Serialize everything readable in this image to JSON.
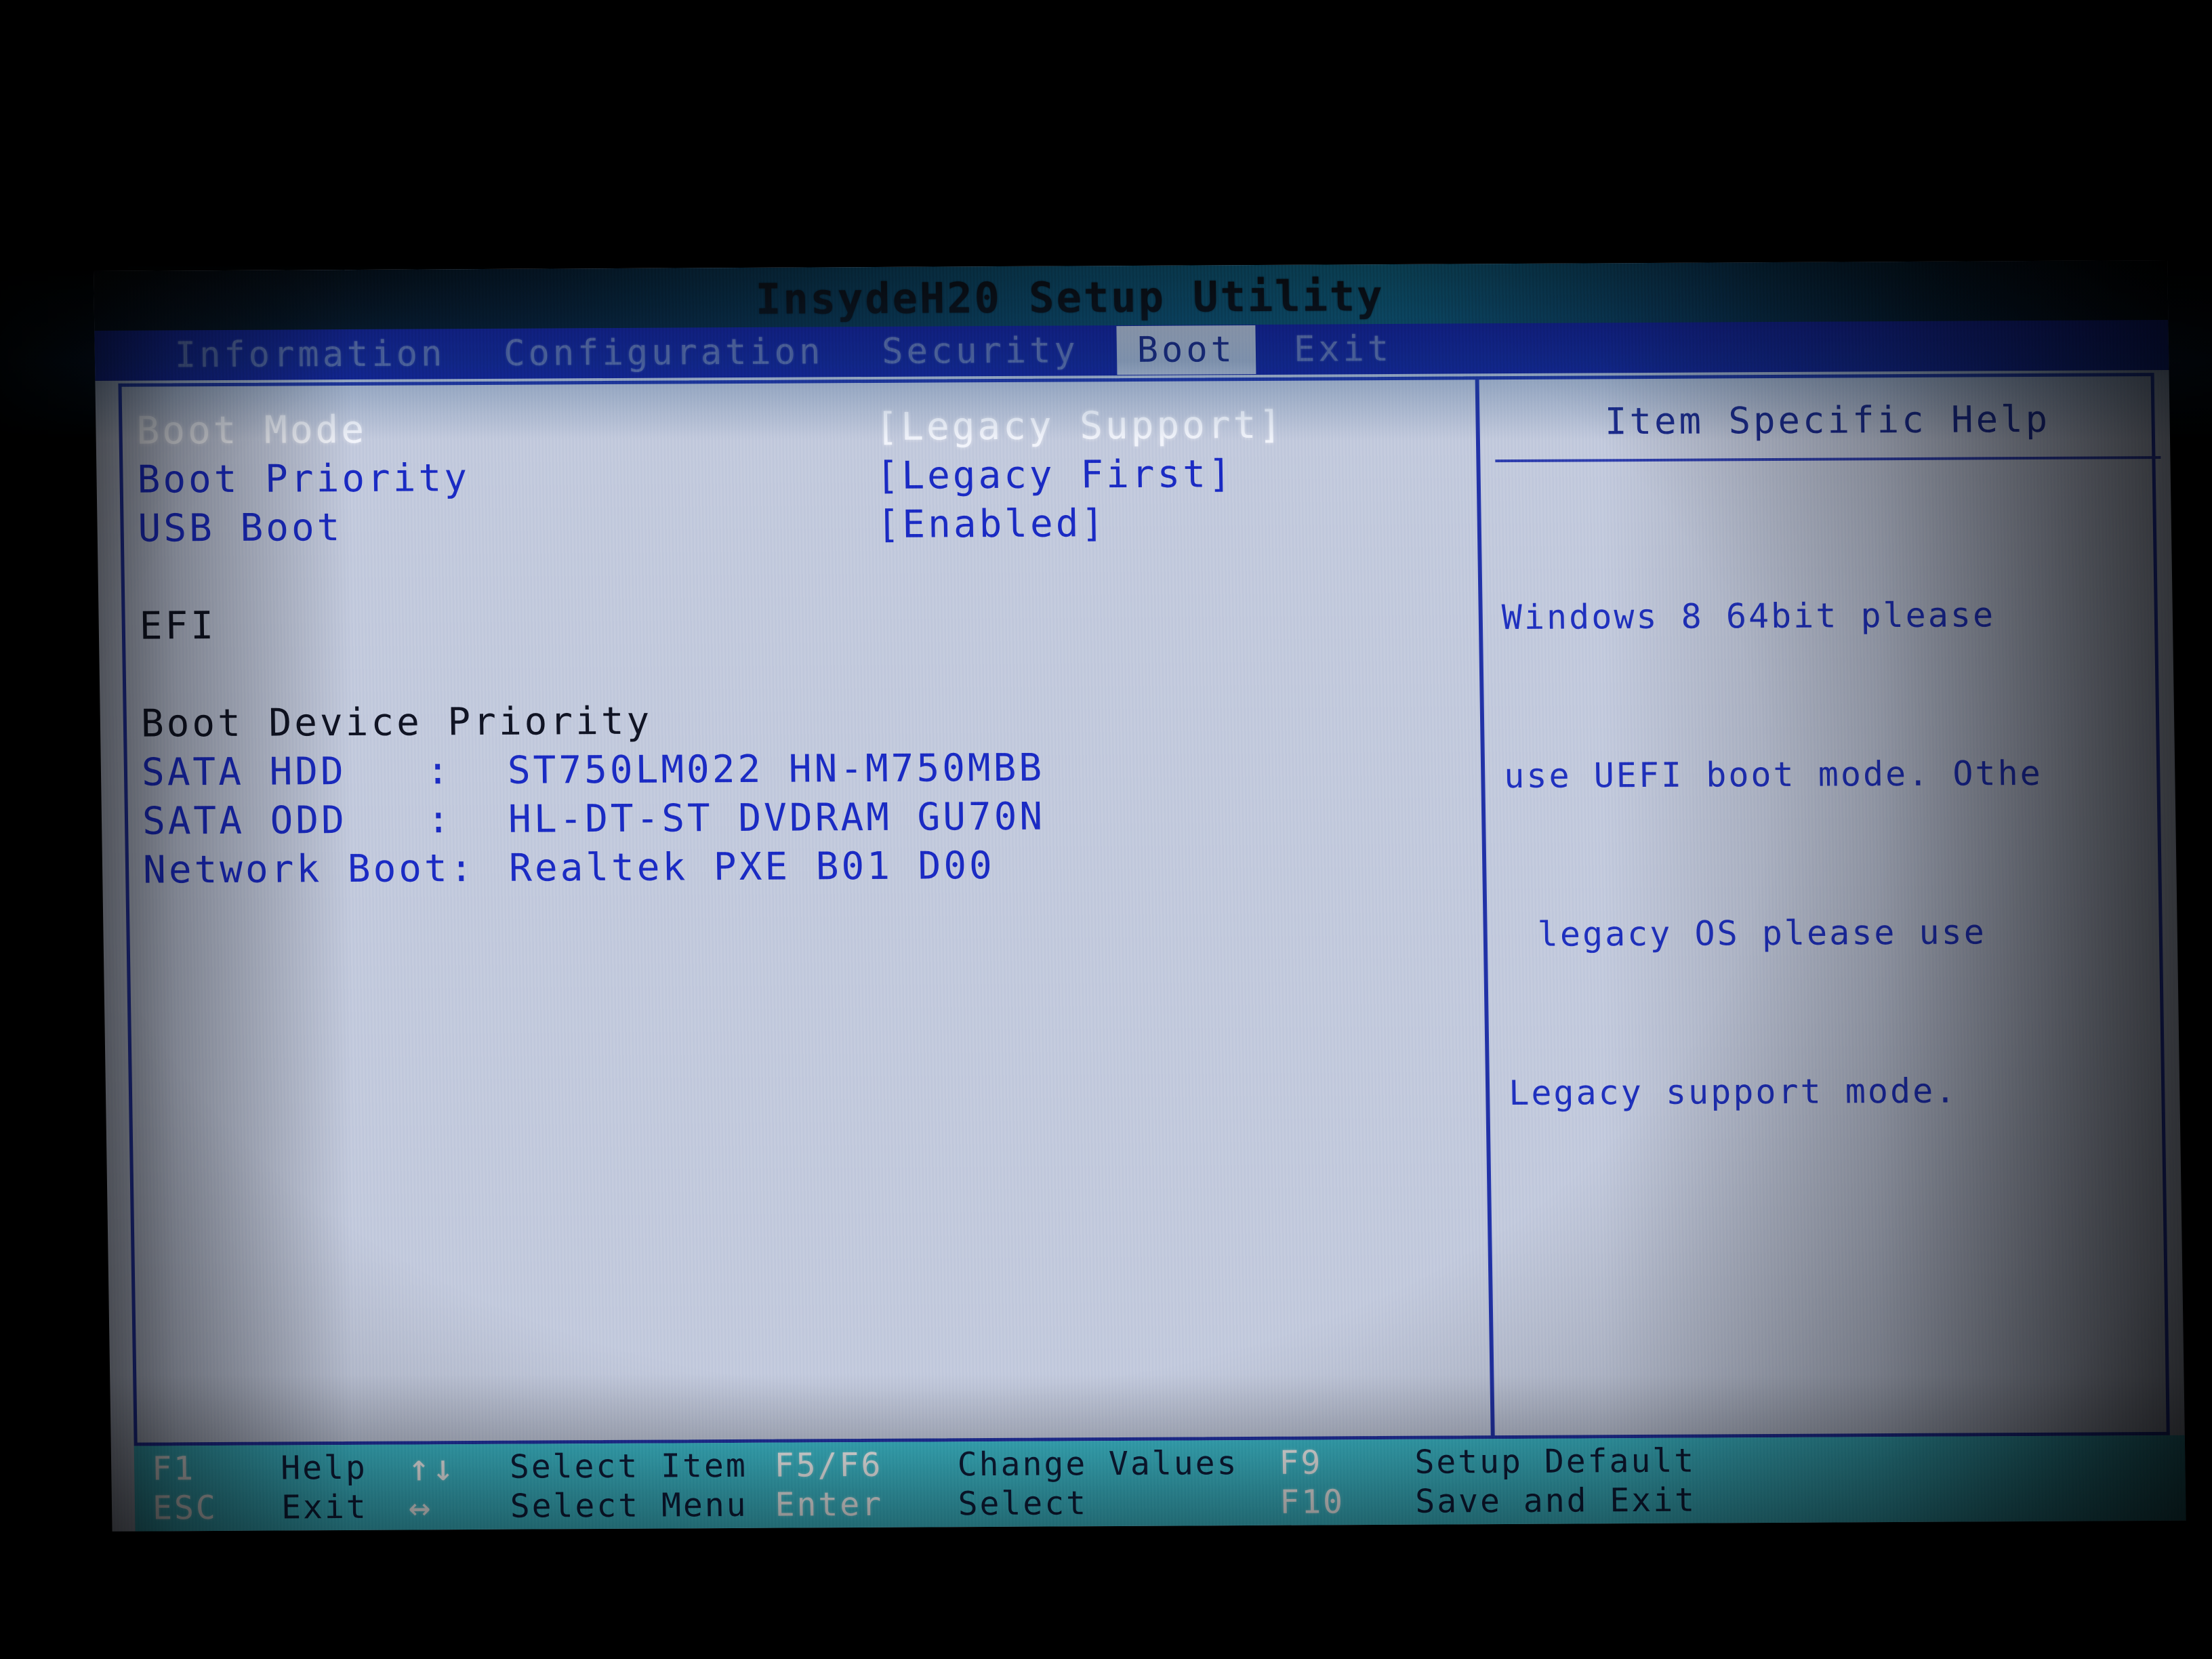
{
  "app": {
    "title": "InsydeH20 Setup Utility"
  },
  "menu": {
    "items": [
      {
        "label": "Information",
        "active": false
      },
      {
        "label": "Configuration",
        "active": false
      },
      {
        "label": "Security",
        "active": false
      },
      {
        "label": "Boot",
        "active": true
      },
      {
        "label": "Exit",
        "active": false
      }
    ]
  },
  "settings": [
    {
      "label": "Boot Mode",
      "value": "[Legacy Support]",
      "selected": true
    },
    {
      "label": "Boot Priority",
      "value": "[Legacy First]",
      "selected": false
    },
    {
      "label": "USB Boot",
      "value": "[Enabled]",
      "selected": false
    }
  ],
  "efi_heading": "EFI",
  "boot_device_priority": {
    "heading": "Boot Device Priority",
    "devices": [
      {
        "name": "SATA HDD",
        "sep": ":",
        "value": "ST750LM022 HN-M750MBB"
      },
      {
        "name": "SATA ODD",
        "sep": ":",
        "value": "HL-DT-ST DVDRAM GU70N"
      },
      {
        "name": "Network Boot:",
        "sep": "",
        "value": "Realtek PXE B01 D00"
      }
    ]
  },
  "help": {
    "title": "Item Specific Help",
    "lines": [
      "Windows 8 64bit please",
      "use UEFI boot mode. Othe",
      "legacy OS please use",
      "Legacy support mode."
    ]
  },
  "function_keys": {
    "group1": [
      {
        "key": "F1",
        "desc": "Help"
      },
      {
        "key": "ESC",
        "desc": "Exit"
      }
    ],
    "group2": [
      {
        "key": "↑↓",
        "desc": "Select Item"
      },
      {
        "key": "↔",
        "desc": "Select Menu"
      }
    ],
    "group3": [
      {
        "key": "F5/F6",
        "desc": "Change Values"
      },
      {
        "key": "Enter",
        "desc": "Select"
      }
    ],
    "group4": [
      {
        "key": "F9",
        "desc": "Setup Default"
      },
      {
        "key": "F10",
        "desc": "Save and Exit"
      }
    ]
  },
  "colors": {
    "menubar_blue": "#141c9b",
    "screen_bg": "#c3cadd",
    "text_blue": "#1a2bc4",
    "selected_white": "#f2f4fb",
    "fkeybar_teal": "#3fc3d4",
    "border_blue": "#2233a8"
  }
}
